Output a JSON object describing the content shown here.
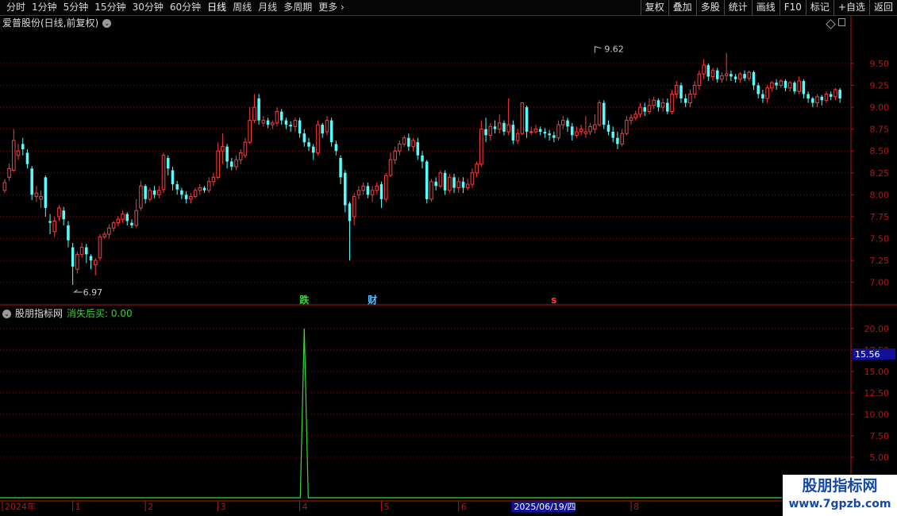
{
  "toolbar": {
    "periods": [
      "分时",
      "1分钟",
      "5分钟",
      "15分钟",
      "30分钟",
      "60分钟",
      "日线",
      "周线",
      "月线",
      "多周期",
      "更多"
    ],
    "more_arrow": "›",
    "active": "日线",
    "buttons": [
      "复权",
      "叠加",
      "多股",
      "统计",
      "画线",
      "F10",
      "标记",
      "+自选",
      "返回"
    ]
  },
  "chart_title": "爱普股份(日线,前复权)",
  "chevron_glyph": "⌄",
  "indicator": {
    "name": "股朋指标网",
    "value_text": "消失后买: 0.00"
  },
  "colors": {
    "up": "#ff3c3c",
    "down": "#54fcfc",
    "grid": "#7a1010",
    "axis": "#b01818",
    "signal": "#36d936",
    "price_label": "#c8c8c8"
  },
  "watermark": {
    "line1": "股朋指标网",
    "line2": "www.7gpzb.com"
  },
  "chart_data": [
    {
      "type": "candlestick",
      "title": "爱普股份(日线,前复权)",
      "y_ticks": [
        7.0,
        7.25,
        7.5,
        7.75,
        8.0,
        8.25,
        8.5,
        8.75,
        9.0,
        9.25,
        9.5
      ],
      "y_tick_labels": [
        "7.00",
        "7.25",
        "7.50",
        "7.75",
        "8.00",
        "8.25",
        "8.50",
        "8.75",
        "9.00",
        "9.25",
        "9.50"
      ],
      "ylim": [
        6.87,
        9.88
      ],
      "grid": true,
      "annotations": {
        "high": {
          "value": 9.62,
          "label": "9.62",
          "index": 130
        },
        "low": {
          "value": 6.97,
          "label": "6.97",
          "index": 15
        }
      },
      "markers": [
        {
          "text": "跌",
          "index": 66,
          "color": "#36d936"
        },
        {
          "text": "财",
          "index": 81,
          "color": "#54c0fc"
        },
        {
          "text": "s",
          "index": 121,
          "color": "#ff3c3c"
        }
      ],
      "candles": [
        [
          8.05,
          8.14,
          8.02,
          8.18
        ],
        [
          8.2,
          8.3,
          8.16,
          8.36
        ],
        [
          8.28,
          8.62,
          8.26,
          8.75
        ],
        [
          8.45,
          8.5,
          8.4,
          8.58
        ],
        [
          8.58,
          8.52,
          8.45,
          8.65
        ],
        [
          8.48,
          8.35,
          8.3,
          8.52
        ],
        [
          8.3,
          8.0,
          7.94,
          8.33
        ],
        [
          7.98,
          8.02,
          7.92,
          8.1
        ],
        [
          7.95,
          7.98,
          7.85,
          8.05
        ],
        [
          8.2,
          7.85,
          7.75,
          8.22
        ],
        [
          7.7,
          7.68,
          7.55,
          7.78
        ],
        [
          7.58,
          7.7,
          7.52,
          7.75
        ],
        [
          7.75,
          7.85,
          7.7,
          7.88
        ],
        [
          7.82,
          7.72,
          7.65,
          7.86
        ],
        [
          7.65,
          7.48,
          7.4,
          7.7
        ],
        [
          7.4,
          7.18,
          6.97,
          7.45
        ],
        [
          7.15,
          7.32,
          7.1,
          7.35
        ],
        [
          7.32,
          7.4,
          7.28,
          7.45
        ],
        [
          7.4,
          7.32,
          7.22,
          7.44
        ],
        [
          7.3,
          7.25,
          7.15,
          7.32
        ],
        [
          7.2,
          7.25,
          7.08,
          7.28
        ],
        [
          7.28,
          7.52,
          7.25,
          7.55
        ],
        [
          7.52,
          7.55,
          7.5,
          7.58
        ],
        [
          7.55,
          7.62,
          7.5,
          7.66
        ],
        [
          7.62,
          7.68,
          7.58,
          7.7
        ],
        [
          7.68,
          7.72,
          7.64,
          7.76
        ],
        [
          7.72,
          7.78,
          7.68,
          7.82
        ],
        [
          7.78,
          7.7,
          7.65,
          7.8
        ],
        [
          7.68,
          7.65,
          7.62,
          7.72
        ],
        [
          7.65,
          7.82,
          7.62,
          7.95
        ],
        [
          7.85,
          8.1,
          7.82,
          8.16
        ],
        [
          8.1,
          7.95,
          7.9,
          8.12
        ],
        [
          7.95,
          8.05,
          7.92,
          8.08
        ],
        [
          8.05,
          8.0,
          7.96,
          8.1
        ],
        [
          8.0,
          8.05,
          7.96,
          8.1
        ],
        [
          8.06,
          8.45,
          8.02,
          8.48
        ],
        [
          8.42,
          8.3,
          8.22,
          8.45
        ],
        [
          8.28,
          8.12,
          8.05,
          8.32
        ],
        [
          8.12,
          8.06,
          8.0,
          8.16
        ],
        [
          8.05,
          8.0,
          7.95,
          8.08
        ],
        [
          8.0,
          7.95,
          7.9,
          8.04
        ],
        [
          7.95,
          7.98,
          7.9,
          8.02
        ],
        [
          7.98,
          8.05,
          7.96,
          8.08
        ],
        [
          8.05,
          8.08,
          8.0,
          8.12
        ],
        [
          8.08,
          8.05,
          8.02,
          8.1
        ],
        [
          8.05,
          8.15,
          8.02,
          8.2
        ],
        [
          8.15,
          8.2,
          8.1,
          8.25
        ],
        [
          8.2,
          8.5,
          8.18,
          8.6
        ],
        [
          8.5,
          8.55,
          8.35,
          8.7
        ],
        [
          8.55,
          8.38,
          8.3,
          8.58
        ],
        [
          8.38,
          8.32,
          8.28,
          8.42
        ],
        [
          8.32,
          8.4,
          8.28,
          8.45
        ],
        [
          8.4,
          8.48,
          8.35,
          8.52
        ],
        [
          8.45,
          8.6,
          8.42,
          8.65
        ],
        [
          8.6,
          8.85,
          8.58,
          9.0
        ],
        [
          8.85,
          9.0,
          8.82,
          9.15
        ],
        [
          9.1,
          8.85,
          8.8,
          9.15
        ],
        [
          8.82,
          8.85,
          8.78,
          8.9
        ],
        [
          8.85,
          8.8,
          8.76,
          8.88
        ],
        [
          8.8,
          8.82,
          8.75,
          8.85
        ],
        [
          8.82,
          8.95,
          8.78,
          9.0
        ],
        [
          8.95,
          8.85,
          8.8,
          8.98
        ],
        [
          8.85,
          8.8,
          8.75,
          8.88
        ],
        [
          8.8,
          8.78,
          8.72,
          8.84
        ],
        [
          8.78,
          8.85,
          8.72,
          8.88
        ],
        [
          8.85,
          8.7,
          8.65,
          8.88
        ],
        [
          8.7,
          8.6,
          8.55,
          8.75
        ],
        [
          8.6,
          8.55,
          8.5,
          8.65
        ],
        [
          8.55,
          8.48,
          8.4,
          8.58
        ],
        [
          8.48,
          8.8,
          8.45,
          8.85
        ],
        [
          8.8,
          8.7,
          8.65,
          8.82
        ],
        [
          8.72,
          8.85,
          8.68,
          8.9
        ],
        [
          8.85,
          8.6,
          8.55,
          8.88
        ],
        [
          8.58,
          8.5,
          8.45,
          8.62
        ],
        [
          8.42,
          8.2,
          8.12,
          8.45
        ],
        [
          8.25,
          7.88,
          7.8,
          8.28
        ],
        [
          7.9,
          7.7,
          7.25,
          7.92
        ],
        [
          7.75,
          7.98,
          7.65,
          8.02
        ],
        [
          8.0,
          8.05,
          7.95,
          8.1
        ],
        [
          8.05,
          8.1,
          8.0,
          8.14
        ],
        [
          8.1,
          8.0,
          7.96,
          8.14
        ],
        [
          8.0,
          8.05,
          7.92,
          8.1
        ],
        [
          8.05,
          8.1,
          8.0,
          8.14
        ],
        [
          8.12,
          7.95,
          7.85,
          8.15
        ],
        [
          7.95,
          8.22,
          7.92,
          8.25
        ],
        [
          8.22,
          8.4,
          8.2,
          8.48
        ],
        [
          8.4,
          8.5,
          8.35,
          8.55
        ],
        [
          8.5,
          8.58,
          8.45,
          8.62
        ],
        [
          8.58,
          8.65,
          8.55,
          8.68
        ],
        [
          8.65,
          8.55,
          8.5,
          8.7
        ],
        [
          8.55,
          8.62,
          8.5,
          8.65
        ],
        [
          8.6,
          8.45,
          8.4,
          8.65
        ],
        [
          8.45,
          8.38,
          8.3,
          8.5
        ],
        [
          8.38,
          7.95,
          7.9,
          8.4
        ],
        [
          7.95,
          8.15,
          7.92,
          8.18
        ],
        [
          8.15,
          8.1,
          8.05,
          8.2
        ],
        [
          8.1,
          8.25,
          8.08,
          8.28
        ],
        [
          8.25,
          8.05,
          8.0,
          8.28
        ],
        [
          8.05,
          8.2,
          8.02,
          8.24
        ],
        [
          8.2,
          8.08,
          8.02,
          8.24
        ],
        [
          8.08,
          8.15,
          8.02,
          8.2
        ],
        [
          8.15,
          8.08,
          8.02,
          8.2
        ],
        [
          8.08,
          8.12,
          8.05,
          8.18
        ],
        [
          8.12,
          8.25,
          8.08,
          8.3
        ],
        [
          8.25,
          8.35,
          8.2,
          8.38
        ],
        [
          8.35,
          8.75,
          8.32,
          8.85
        ],
        [
          8.75,
          8.68,
          8.6,
          8.88
        ],
        [
          8.68,
          8.78,
          8.62,
          8.82
        ],
        [
          8.78,
          8.75,
          8.7,
          8.85
        ],
        [
          8.75,
          8.82,
          8.7,
          8.92
        ],
        [
          8.82,
          8.72,
          8.68,
          8.85
        ],
        [
          8.72,
          8.8,
          8.68,
          9.1
        ],
        [
          8.8,
          8.62,
          8.58,
          8.85
        ],
        [
          8.62,
          8.7,
          8.58,
          8.75
        ],
        [
          8.7,
          9.05,
          8.68,
          9.05
        ],
        [
          9.0,
          8.72,
          8.65,
          9.02
        ],
        [
          8.72,
          8.72,
          8.68,
          8.78
        ],
        [
          8.72,
          8.75,
          8.7,
          8.8
        ],
        [
          8.75,
          8.72,
          8.68,
          8.78
        ],
        [
          8.72,
          8.7,
          8.65,
          8.76
        ],
        [
          8.7,
          8.68,
          8.62,
          8.74
        ],
        [
          8.68,
          8.65,
          8.6,
          8.72
        ],
        [
          8.65,
          8.8,
          8.62,
          8.85
        ],
        [
          8.8,
          8.85,
          8.75,
          8.9
        ],
        [
          8.85,
          8.78,
          8.72,
          8.88
        ],
        [
          8.78,
          8.68,
          8.62,
          8.82
        ],
        [
          8.68,
          8.72,
          8.65,
          8.78
        ],
        [
          8.72,
          8.75,
          8.68,
          8.8
        ],
        [
          8.7,
          8.72,
          8.65,
          8.9
        ],
        [
          8.72,
          8.78,
          8.68,
          8.82
        ],
        [
          8.75,
          8.8,
          8.7,
          8.92
        ],
        [
          8.8,
          9.05,
          8.78,
          9.08
        ],
        [
          9.05,
          8.8,
          8.75,
          9.08
        ],
        [
          8.8,
          8.72,
          8.68,
          8.85
        ],
        [
          8.72,
          8.65,
          8.6,
          8.78
        ],
        [
          8.65,
          8.58,
          8.52,
          8.72
        ],
        [
          8.58,
          8.7,
          8.55,
          8.75
        ],
        [
          8.7,
          8.85,
          8.68,
          8.9
        ],
        [
          8.85,
          8.88,
          8.8,
          8.92
        ],
        [
          8.88,
          8.92,
          8.85,
          8.96
        ],
        [
          8.92,
          9.0,
          8.88,
          9.05
        ],
        [
          9.0,
          8.95,
          8.9,
          9.05
        ],
        [
          8.95,
          9.02,
          8.92,
          9.1
        ],
        [
          9.02,
          9.08,
          8.98,
          9.12
        ],
        [
          9.08,
          9.0,
          8.95,
          9.1
        ],
        [
          9.0,
          9.05,
          8.95,
          9.1
        ],
        [
          9.05,
          8.95,
          8.92,
          9.1
        ],
        [
          8.95,
          9.15,
          8.92,
          9.2
        ],
        [
          9.15,
          9.25,
          9.1,
          9.3
        ],
        [
          9.25,
          9.1,
          9.05,
          9.28
        ],
        [
          9.1,
          9.05,
          9.0,
          9.15
        ],
        [
          9.05,
          9.15,
          9.0,
          9.2
        ],
        [
          9.15,
          9.25,
          9.1,
          9.3
        ],
        [
          9.25,
          9.38,
          9.2,
          9.42
        ],
        [
          9.38,
          9.48,
          9.32,
          9.55
        ],
        [
          9.48,
          9.35,
          9.3,
          9.5
        ],
        [
          9.35,
          9.42,
          9.3,
          9.45
        ],
        [
          9.42,
          9.32,
          9.28,
          9.45
        ],
        [
          9.32,
          9.36,
          9.28,
          9.4
        ],
        [
          9.36,
          9.38,
          9.3,
          9.62
        ],
        [
          9.38,
          9.35,
          9.3,
          9.42
        ],
        [
          9.35,
          9.32,
          9.28,
          9.38
        ],
        [
          9.32,
          9.38,
          9.28,
          9.4
        ],
        [
          9.38,
          9.33,
          9.3,
          9.42
        ],
        [
          9.33,
          9.4,
          9.3,
          9.42
        ],
        [
          9.4,
          9.25,
          9.2,
          9.42
        ],
        [
          9.25,
          9.15,
          9.1,
          9.28
        ],
        [
          9.15,
          9.1,
          9.05,
          9.2
        ],
        [
          9.1,
          9.22,
          9.05,
          9.25
        ],
        [
          9.22,
          9.28,
          9.18,
          9.3
        ],
        [
          9.28,
          9.25,
          9.2,
          9.32
        ],
        [
          9.25,
          9.3,
          9.22,
          9.32
        ],
        [
          9.3,
          9.22,
          9.18,
          9.32
        ],
        [
          9.22,
          9.28,
          9.18,
          9.3
        ],
        [
          9.28,
          9.18,
          9.15,
          9.3
        ],
        [
          9.18,
          9.3,
          9.15,
          9.35
        ],
        [
          9.3,
          9.15,
          9.1,
          9.32
        ],
        [
          9.15,
          9.1,
          9.05,
          9.18
        ],
        [
          9.1,
          9.05,
          9.0,
          9.12
        ],
        [
          9.05,
          9.12,
          9.0,
          9.15
        ],
        [
          9.12,
          9.08,
          9.02,
          9.14
        ],
        [
          9.08,
          9.15,
          9.05,
          9.18
        ],
        [
          9.15,
          9.12,
          9.08,
          9.18
        ],
        [
          9.12,
          9.2,
          9.08,
          9.22
        ],
        [
          9.2,
          9.1,
          9.05,
          9.22
        ]
      ]
    },
    {
      "type": "line",
      "title": "股朋指标网",
      "series": [
        {
          "name": "消失后买",
          "spike_index": 66,
          "peak": 20.0,
          "values_note": ""
        }
      ],
      "y_ticks": [
        5.0,
        7.5,
        10.0,
        12.5,
        15.0,
        17.5,
        20.0
      ],
      "y_tick_labels": [
        "5.00",
        "7.50",
        "10.00",
        "12.50",
        "15.00",
        "17.50",
        "20.00"
      ],
      "ylim": [
        0,
        21
      ],
      "current_value_label": "15.56",
      "grid": true
    }
  ],
  "x_axis": {
    "labels": [
      {
        "text": "2024年",
        "index": 0
      },
      {
        "text": "1",
        "index": 15
      },
      {
        "text": "2",
        "index": 31
      },
      {
        "text": "3",
        "index": 47
      },
      {
        "text": "4",
        "index": 65
      },
      {
        "text": "5",
        "index": 83
      },
      {
        "text": "6",
        "index": 100
      },
      {
        "text": "8",
        "index": 138
      }
    ],
    "cursor_label": "2025/06/19/四",
    "cursor_index": 112
  }
}
